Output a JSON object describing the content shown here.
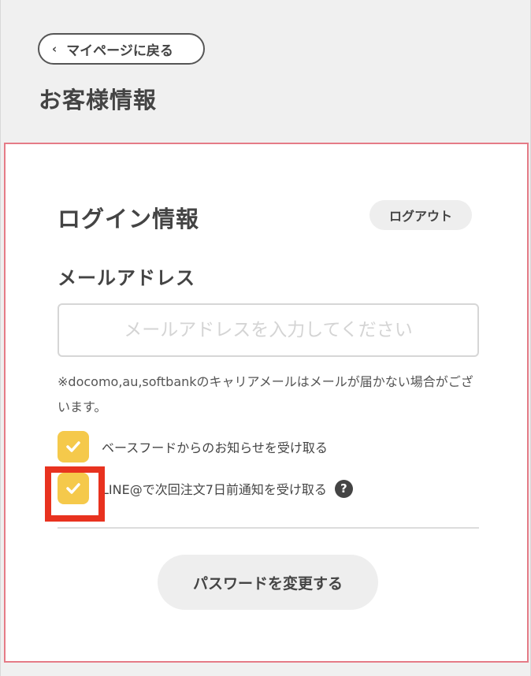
{
  "header": {
    "back_label": "マイページに戻る",
    "page_title": "お客様情報"
  },
  "login_section": {
    "title": "ログイン情報",
    "logout_label": "ログアウト",
    "email_label": "メールアドレス",
    "email_value": "",
    "email_placeholder": "メールアドレスを入力してください",
    "note": "※docomo,au,softbankのキャリアメールはメールが届かない場合がございます。",
    "checkboxes": [
      {
        "label": "ベースフードからのお知らせを受け取る",
        "checked": true
      },
      {
        "label": "LINE@で次回注文7日前通知を受け取る",
        "checked": true
      }
    ],
    "help_icon_glyph": "?",
    "change_password_label": "パスワードを変更する"
  },
  "colors": {
    "card_border": "#e57b87",
    "checkbox_fill": "#f5c94b",
    "highlight": "#e8321f",
    "background": "#f0f0f0"
  },
  "icons": [
    "chevron-left-icon",
    "check-icon",
    "help-icon"
  ]
}
